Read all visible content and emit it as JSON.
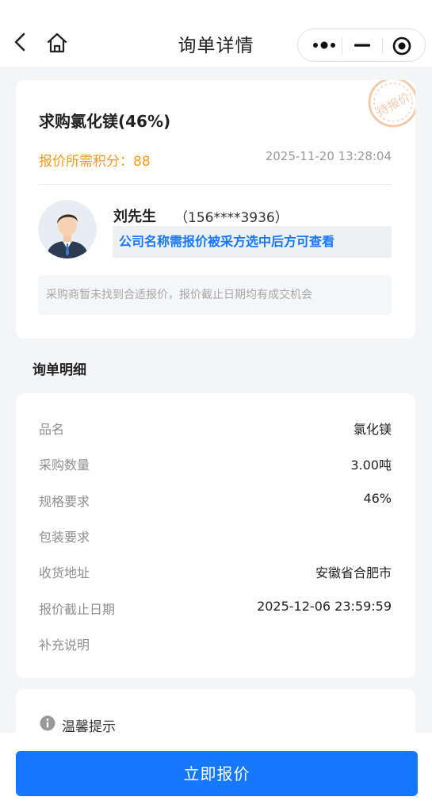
{
  "nav": {
    "title": "询单详情"
  },
  "summary": {
    "product_title": "求购氯化镁(46%)",
    "points_label": "报价所需积分：",
    "points_value": "88",
    "timestamp": "2025-11-20 13:28:04",
    "stamp_text": "待报价"
  },
  "contact": {
    "name": "刘先生",
    "phone": "（156****3936）",
    "company_note": "公司名称需报价被采方选中后方可查看",
    "hint": "采购商暂未找到合适报价，报价截止日期均有成交机会"
  },
  "details": {
    "section_title": "询单明细",
    "rows": [
      {
        "label": "品名",
        "value": "氯化镁"
      },
      {
        "label": "采购数量",
        "value": "3.00吨"
      },
      {
        "label": "规格要求",
        "value": "46%"
      },
      {
        "label": "包装要求",
        "value": ""
      },
      {
        "label": "收货地址",
        "value": "安徽省合肥市"
      },
      {
        "label": "报价截止日期",
        "value": "2025-12-06 23:59:59"
      },
      {
        "label": "补充说明",
        "value": ""
      }
    ]
  },
  "tip": {
    "title": "温馨提示"
  },
  "action": {
    "quote_button": "立即报价"
  },
  "colors": {
    "primary": "#1677ff",
    "accent_orange": "#f29a1a",
    "stamp": "#f0b48a"
  }
}
